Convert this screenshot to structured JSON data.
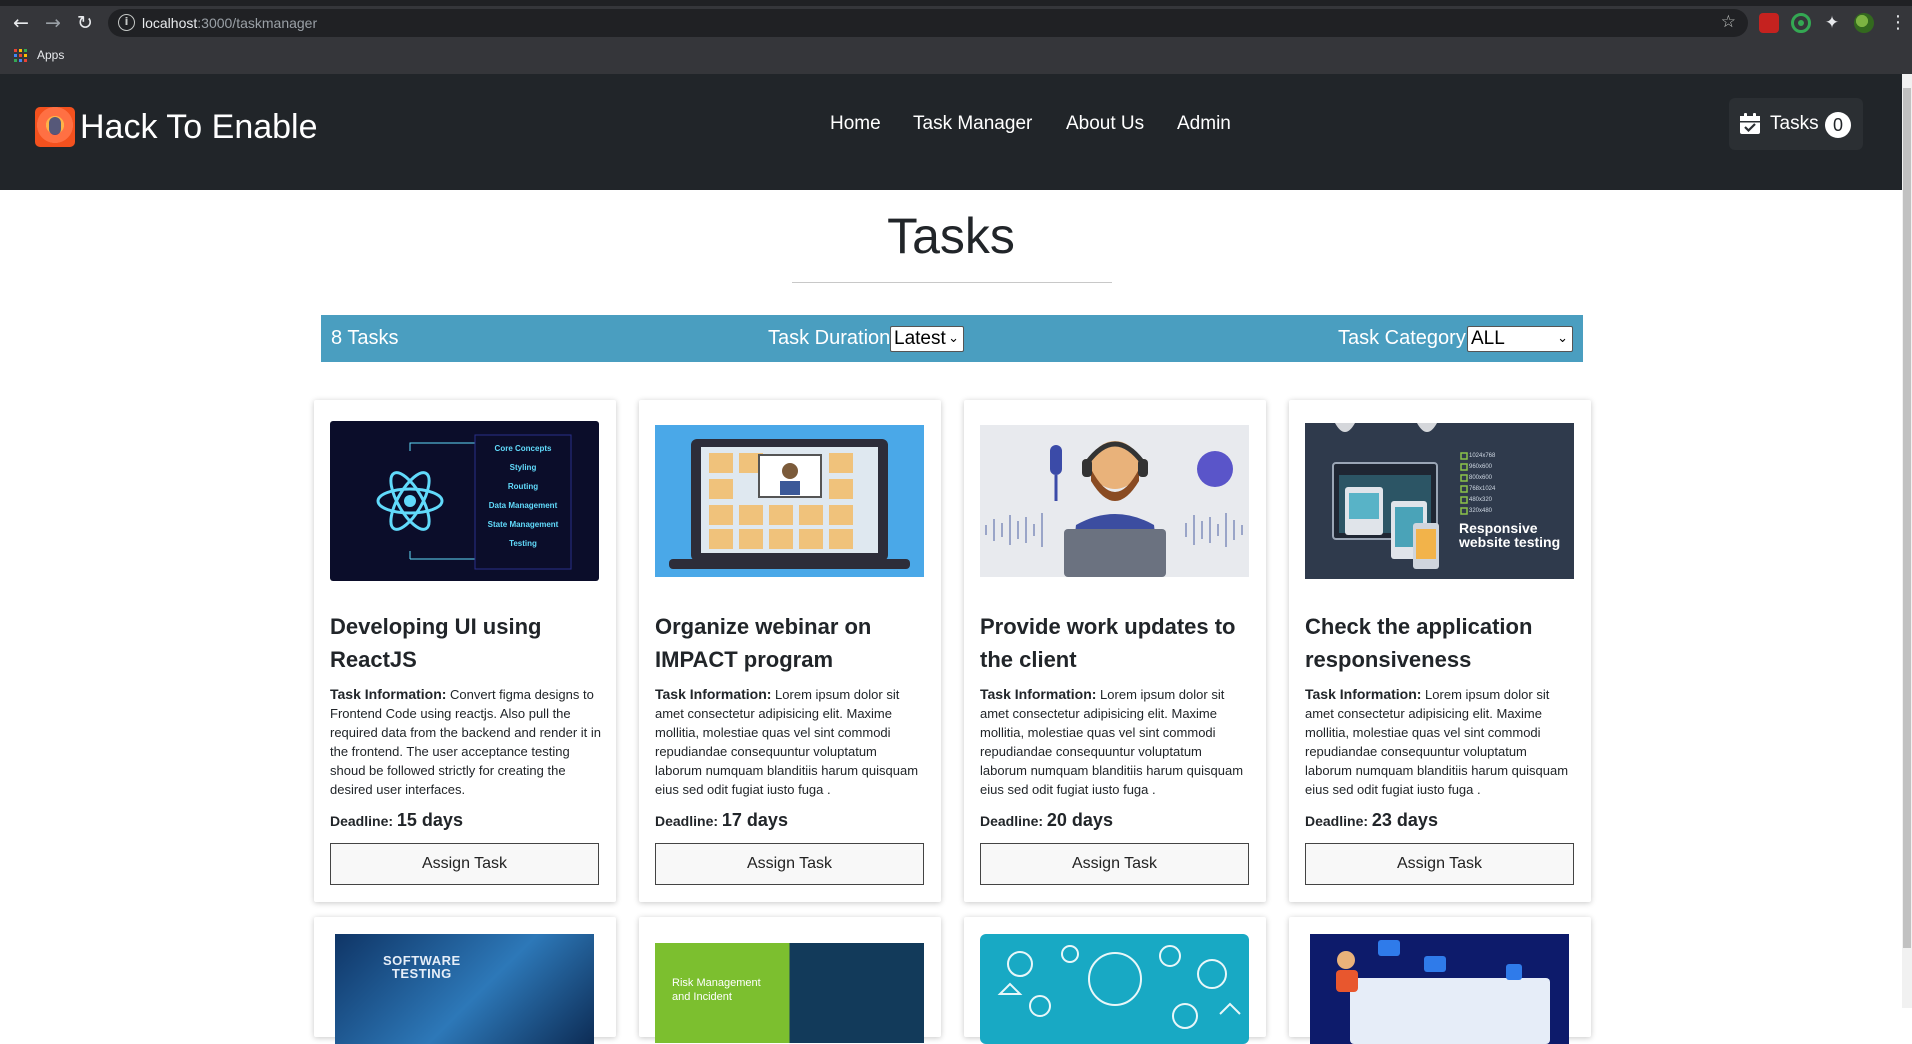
{
  "browser": {
    "url_host": "localhost",
    "url_path": ":3000/taskmanager",
    "bookmarks_apps_label": "Apps"
  },
  "navbar": {
    "brand": "Hack To Enable",
    "links": [
      "Home",
      "Task Manager",
      "About Us",
      "Admin"
    ],
    "tasks_button_label": "Tasks",
    "tasks_count": "0"
  },
  "page": {
    "title": "Tasks"
  },
  "filters": {
    "count_label": "8 Tasks",
    "duration_label": "Task Duration",
    "duration_selected": "Latest",
    "category_label": "Task Category",
    "category_selected": "ALL"
  },
  "labels": {
    "task_information": "Task Information:",
    "deadline": "Deadline:",
    "assign_button": "Assign Task"
  },
  "tasks": [
    {
      "title": "Developing UI using ReactJS",
      "info": "Convert figma designs to Frontend Code using reactjs. Also pull the required data from the backend and render it in the frontend. The user acceptance testing shoud be followed strictly for creating the desired user interfaces.",
      "deadline": "15 days",
      "image_labels": [
        "Core Concepts",
        "Styling",
        "Routing",
        "Data Management",
        "State Management",
        "Testing"
      ]
    },
    {
      "title": "Organize webinar on IMPACT program",
      "info": "Lorem ipsum dolor sit amet consectetur adipisicing elit. Maxime mollitia, molestiae quas vel sint commodi repudiandae consequuntur voluptatum laborum numquam blanditiis harum quisquam eius sed odit fugiat iusto fuga .",
      "deadline": "17 days"
    },
    {
      "title": "Provide work updates to the client",
      "info": "Lorem ipsum dolor sit amet consectetur adipisicing elit. Maxime mollitia, molestiae quas vel sint commodi repudiandae consequuntur voluptatum laborum numquam blanditiis harum quisquam eius sed odit fugiat iusto fuga .",
      "deadline": "20 days"
    },
    {
      "title": "Check the application responsiveness",
      "info": "Lorem ipsum dolor sit amet consectetur adipisicing elit. Maxime mollitia, molestiae quas vel sint commodi repudiandae consequuntur voluptatum laborum numquam blanditiis harum quisquam eius sed odit fugiat iusto fuga .",
      "deadline": "23 days",
      "image_labels": [
        "Responsive",
        "website testing",
        "1024x768",
        "960x600",
        "800x600",
        "768x1024",
        "480x320",
        "320x480"
      ]
    },
    {
      "image_labels": [
        "SOFTWARE",
        "TESTING"
      ]
    },
    {
      "image_labels": [
        "Risk Management",
        "and Incident"
      ]
    },
    {},
    {}
  ],
  "colors": {
    "navbar_bg": "#212529",
    "filter_bar_bg": "#4a9ec0"
  }
}
